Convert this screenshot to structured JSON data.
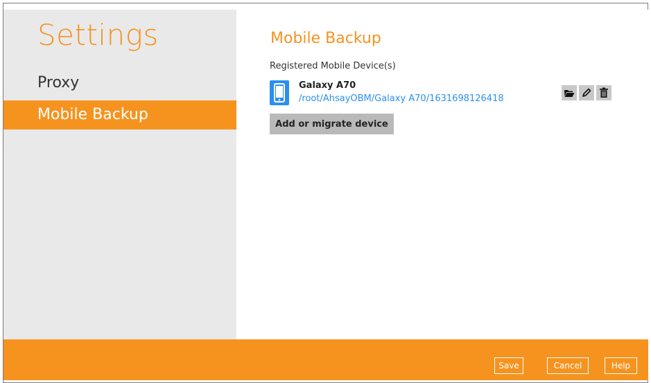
{
  "sidebar": {
    "title": "Settings",
    "items": [
      {
        "label": "Proxy",
        "active": false
      },
      {
        "label": "Mobile Backup",
        "active": true
      }
    ]
  },
  "main": {
    "heading": "Mobile Backup",
    "section_label": "Registered Mobile Device(s)",
    "device": {
      "name": "Galaxy A70",
      "path": "/root/AhsayOBM/Galaxy A70/1631698126418",
      "icon": "smartphone-icon",
      "actions": [
        "folder-open-icon",
        "pencil-icon",
        "trash-icon"
      ]
    },
    "add_button": "Add or migrate device"
  },
  "footer": {
    "save": "Save",
    "cancel": "Cancel",
    "help": "Help"
  },
  "colors": {
    "accent": "#f6931f",
    "sidebar_bg": "#e9e9e9",
    "link": "#2a8ff0"
  }
}
